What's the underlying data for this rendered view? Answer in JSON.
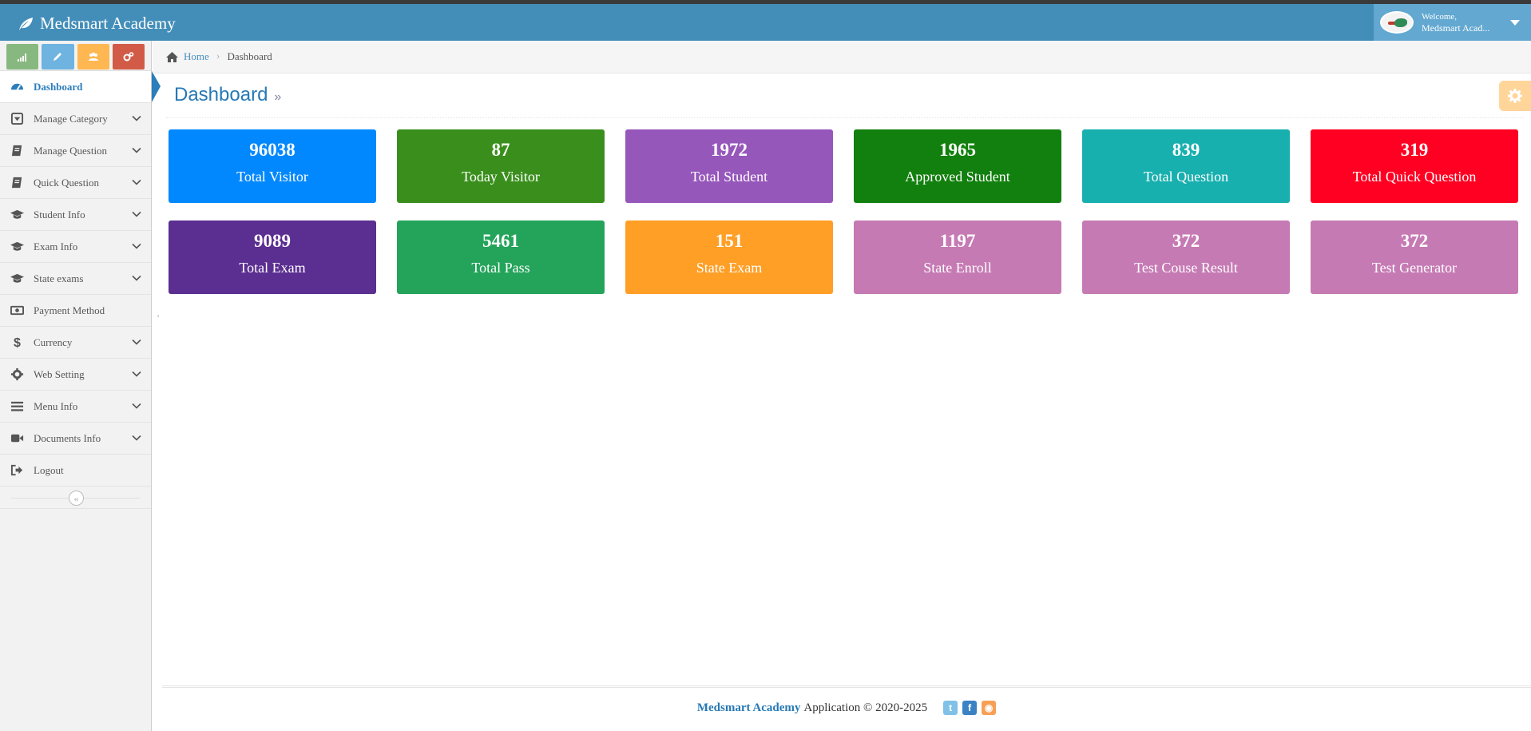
{
  "app": {
    "brand": "Medsmart Academy"
  },
  "user": {
    "welcome": "Welcome,",
    "name": "Medsmart Acad..."
  },
  "shortcuts": [
    {
      "name": "stats-shortcut-button",
      "color": "#87b87f",
      "icon": "signal-icon"
    },
    {
      "name": "edit-shortcut-button",
      "color": "#6fb3e0",
      "icon": "pencil-icon"
    },
    {
      "name": "users-shortcut-button",
      "color": "#ffb752",
      "icon": "users-icon"
    },
    {
      "name": "settings-shortcut-button",
      "color": "#d15b47",
      "icon": "cogs-icon"
    }
  ],
  "sidebar": {
    "items": [
      {
        "label": "Dashboard",
        "icon": "tachometer-icon",
        "active": true,
        "hasChevron": false
      },
      {
        "label": "Manage Category",
        "icon": "caret-square-icon",
        "hasChevron": true
      },
      {
        "label": "Manage Question",
        "icon": "book-icon",
        "hasChevron": true
      },
      {
        "label": "Quick Question",
        "icon": "book-icon",
        "hasChevron": true
      },
      {
        "label": "Student Info",
        "icon": "graduation-cap-icon",
        "hasChevron": true
      },
      {
        "label": "Exam Info",
        "icon": "graduation-cap-icon",
        "hasChevron": true
      },
      {
        "label": "State exams",
        "icon": "graduation-cap-icon",
        "hasChevron": true
      },
      {
        "label": "Payment Method",
        "icon": "money-icon",
        "hasChevron": false
      },
      {
        "label": "Currency",
        "icon": "dollar-icon",
        "hasChevron": true
      },
      {
        "label": "Web Setting",
        "icon": "gear-icon",
        "hasChevron": true
      },
      {
        "label": "Menu Info",
        "icon": "bars-icon",
        "hasChevron": true
      },
      {
        "label": "Documents Info",
        "icon": "video-camera-icon",
        "hasChevron": true
      },
      {
        "label": "Logout",
        "icon": "sign-out-icon",
        "hasChevron": false
      }
    ]
  },
  "breadcrumb": {
    "home": "Home",
    "current": "Dashboard"
  },
  "page": {
    "title": "Dashboard",
    "title_suffix": "»"
  },
  "tick_mark": "'",
  "stats": [
    {
      "value": "96038",
      "label": "Total Visitor",
      "color": "#0288fe"
    },
    {
      "value": "87",
      "label": "Today Visitor",
      "color": "#3a8f1c"
    },
    {
      "value": "1972",
      "label": "Total Student",
      "color": "#9657bb"
    },
    {
      "value": "1965",
      "label": "Approved Student",
      "color": "#12800e"
    },
    {
      "value": "839",
      "label": "Total Question",
      "color": "#18afaf"
    },
    {
      "value": "319",
      "label": "Total Quick Question",
      "color": "#ff0022"
    },
    {
      "value": "9089",
      "label": "Total Exam",
      "color": "#5b2e91"
    },
    {
      "value": "5461",
      "label": "Total Pass",
      "color": "#24a45a"
    },
    {
      "value": "151",
      "label": "State Exam",
      "color": "#ff9f26"
    },
    {
      "value": "1197",
      "label": "State Enroll",
      "color": "#c67ab4"
    },
    {
      "value": "372",
      "label": "Test Couse Result",
      "color": "#c67ab4"
    },
    {
      "value": "372",
      "label": "Test Generator",
      "color": "#c67ab4"
    }
  ],
  "footer": {
    "brand": "Medsmart Academy",
    "text": "Application © 2020-2025",
    "social": [
      {
        "name": "twitter-icon",
        "glyph": "t",
        "color": "#80c1e8"
      },
      {
        "name": "facebook-icon",
        "glyph": "f",
        "color": "#3b82c4"
      },
      {
        "name": "rss-icon",
        "glyph": "◉",
        "color": "#f7a055"
      }
    ]
  }
}
